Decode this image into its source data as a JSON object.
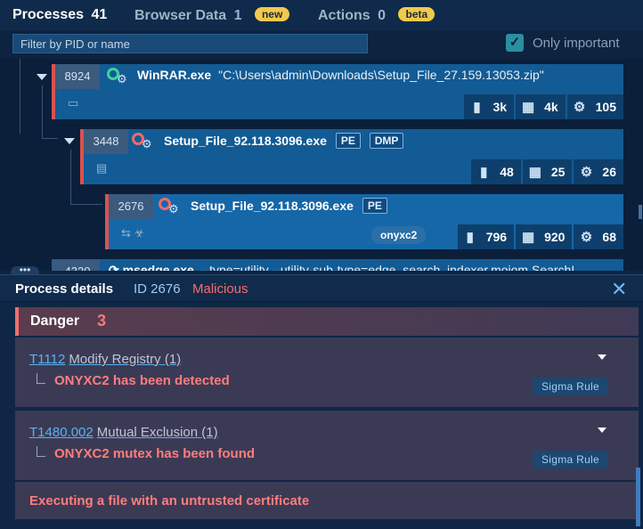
{
  "tabs": [
    {
      "label": "Processes",
      "count": "41",
      "badge": ""
    },
    {
      "label": "Browser Data",
      "count": "1",
      "badge": "new"
    },
    {
      "label": "Actions",
      "count": "0",
      "badge": "beta"
    }
  ],
  "filter": {
    "placeholder": "Filter by PID or name"
  },
  "only_important": {
    "label": "Only important",
    "checked": true
  },
  "processes": [
    {
      "pid": "8924",
      "name": "WinRAR.exe",
      "args": "\"C:\\Users\\admin\\Downloads\\Setup_File_27.159.13053.zip\"",
      "tags": [],
      "status_icon": "verified-icon",
      "stats": [
        "3k",
        "4k",
        "105"
      ]
    },
    {
      "pid": "3448",
      "name": "Setup_File_92.118.3096.exe",
      "args": "",
      "tags": [
        "PE",
        "DMP"
      ],
      "status_icon": "malicious-icon",
      "stats": [
        "48",
        "25",
        "26"
      ]
    },
    {
      "pid": "2676",
      "name": "Setup_File_92.118.3096.exe",
      "args": "",
      "tags": [
        "PE"
      ],
      "status_icon": "malicious-icon",
      "yara": "onyxc2",
      "stats": [
        "796",
        "920",
        "68"
      ]
    },
    {
      "pid": "4320",
      "name": "msedge.exe",
      "args": "--type=utility --utility-sub-type=edge_search_indexer.mojom.SearchI..."
    }
  ],
  "details": {
    "title": "Process details",
    "id_text": "ID 2676",
    "status": "Malicious",
    "danger_label": "Danger",
    "danger_count": "3",
    "items": [
      {
        "tid": "T1112",
        "name": "Modify Registry",
        "count": "(1)",
        "detail": "ONYXC2 has been detected",
        "badge": "Sigma Rule"
      },
      {
        "tid": "T1480.002",
        "name": "Mutual Exclusion",
        "count": "(1)",
        "detail": "ONYXC2 mutex has been found",
        "badge": "Sigma Rule"
      }
    ],
    "plain_item": "Executing a file with an untrusted certificate"
  },
  "colors": {
    "malicious": "#ff6b6b",
    "accent": "#58b4f2",
    "badge_yellow": "#f2c94c"
  }
}
